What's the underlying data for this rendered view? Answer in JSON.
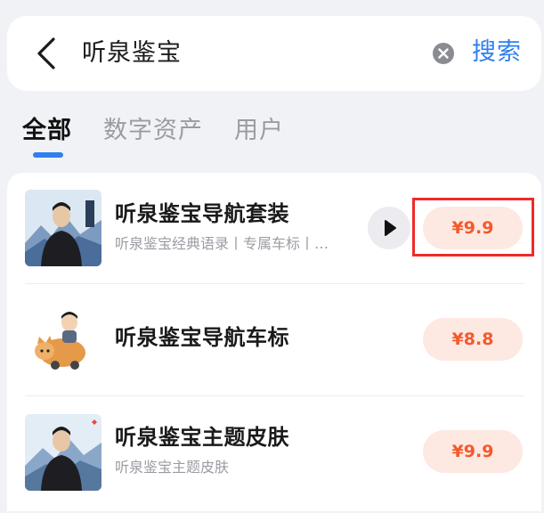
{
  "search": {
    "query": "听泉鉴宝",
    "submit_label": "搜索",
    "back_icon": "chevron-left-icon",
    "clear_icon": "clear-circle-icon"
  },
  "tabs": [
    {
      "label": "全部",
      "active": true
    },
    {
      "label": "数字资产",
      "active": false
    },
    {
      "label": "用户",
      "active": false
    }
  ],
  "results": [
    {
      "title": "听泉鉴宝导航套装",
      "subtitle": "听泉鉴宝经典语录丨专属车标丨…",
      "price": "¥9.9",
      "has_preview": true
    },
    {
      "title": "听泉鉴宝导航车标",
      "subtitle": "",
      "price": "¥8.8",
      "has_preview": false
    },
    {
      "title": "听泉鉴宝主题皮肤",
      "subtitle": "听泉鉴宝主题皮肤",
      "price": "¥9.9",
      "has_preview": false
    }
  ],
  "colors": {
    "accent": "#2f7ff0",
    "price_text": "#f15a2b",
    "price_bg": "#fde8e2",
    "highlight": "#f02a2a"
  }
}
